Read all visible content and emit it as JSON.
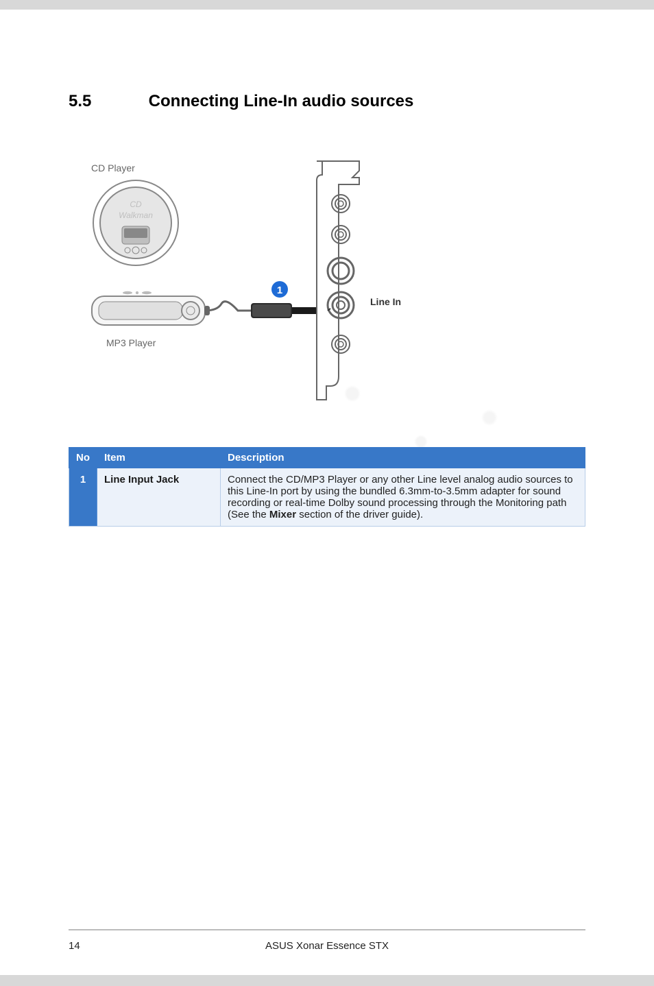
{
  "section": {
    "number": "5.5",
    "title": "Connecting Line-In audio sources"
  },
  "diagram": {
    "cd_player_label": "CD Player",
    "cd_disc_text_top": "CD",
    "cd_disc_text_bottom": "Walkman",
    "mp3_player_label": "MP3 Player",
    "callout_number": "1",
    "line_in_label": "Line In"
  },
  "table": {
    "headers": {
      "no": "No",
      "item": "Item",
      "description": "Description"
    },
    "rows": [
      {
        "no": "1",
        "item": "Line Input Jack",
        "description_pre": "Connect the CD/MP3 Player or any other Line level analog audio sources to this Line-In port by using the bundled 6.3mm-to-3.5mm adapter for sound recording or real-time Dolby sound processing through the Monitoring path (See the ",
        "description_bold": "Mixer",
        "description_post": " section of the driver guide)."
      }
    ]
  },
  "footer": {
    "page_number": "14",
    "product": "ASUS Xonar Essence STX"
  },
  "chart_data": {
    "type": "table",
    "title": "Line-In audio source connector description",
    "columns": [
      "No",
      "Item",
      "Description"
    ],
    "rows": [
      [
        "1",
        "Line Input Jack",
        "Connect the CD/MP3 Player or any other Line level analog audio sources to this Line-In port by using the bundled 6.3mm-to-3.5mm adapter for sound recording or real-time Dolby sound processing through the Monitoring path (See the Mixer section of the driver guide)."
      ]
    ]
  }
}
